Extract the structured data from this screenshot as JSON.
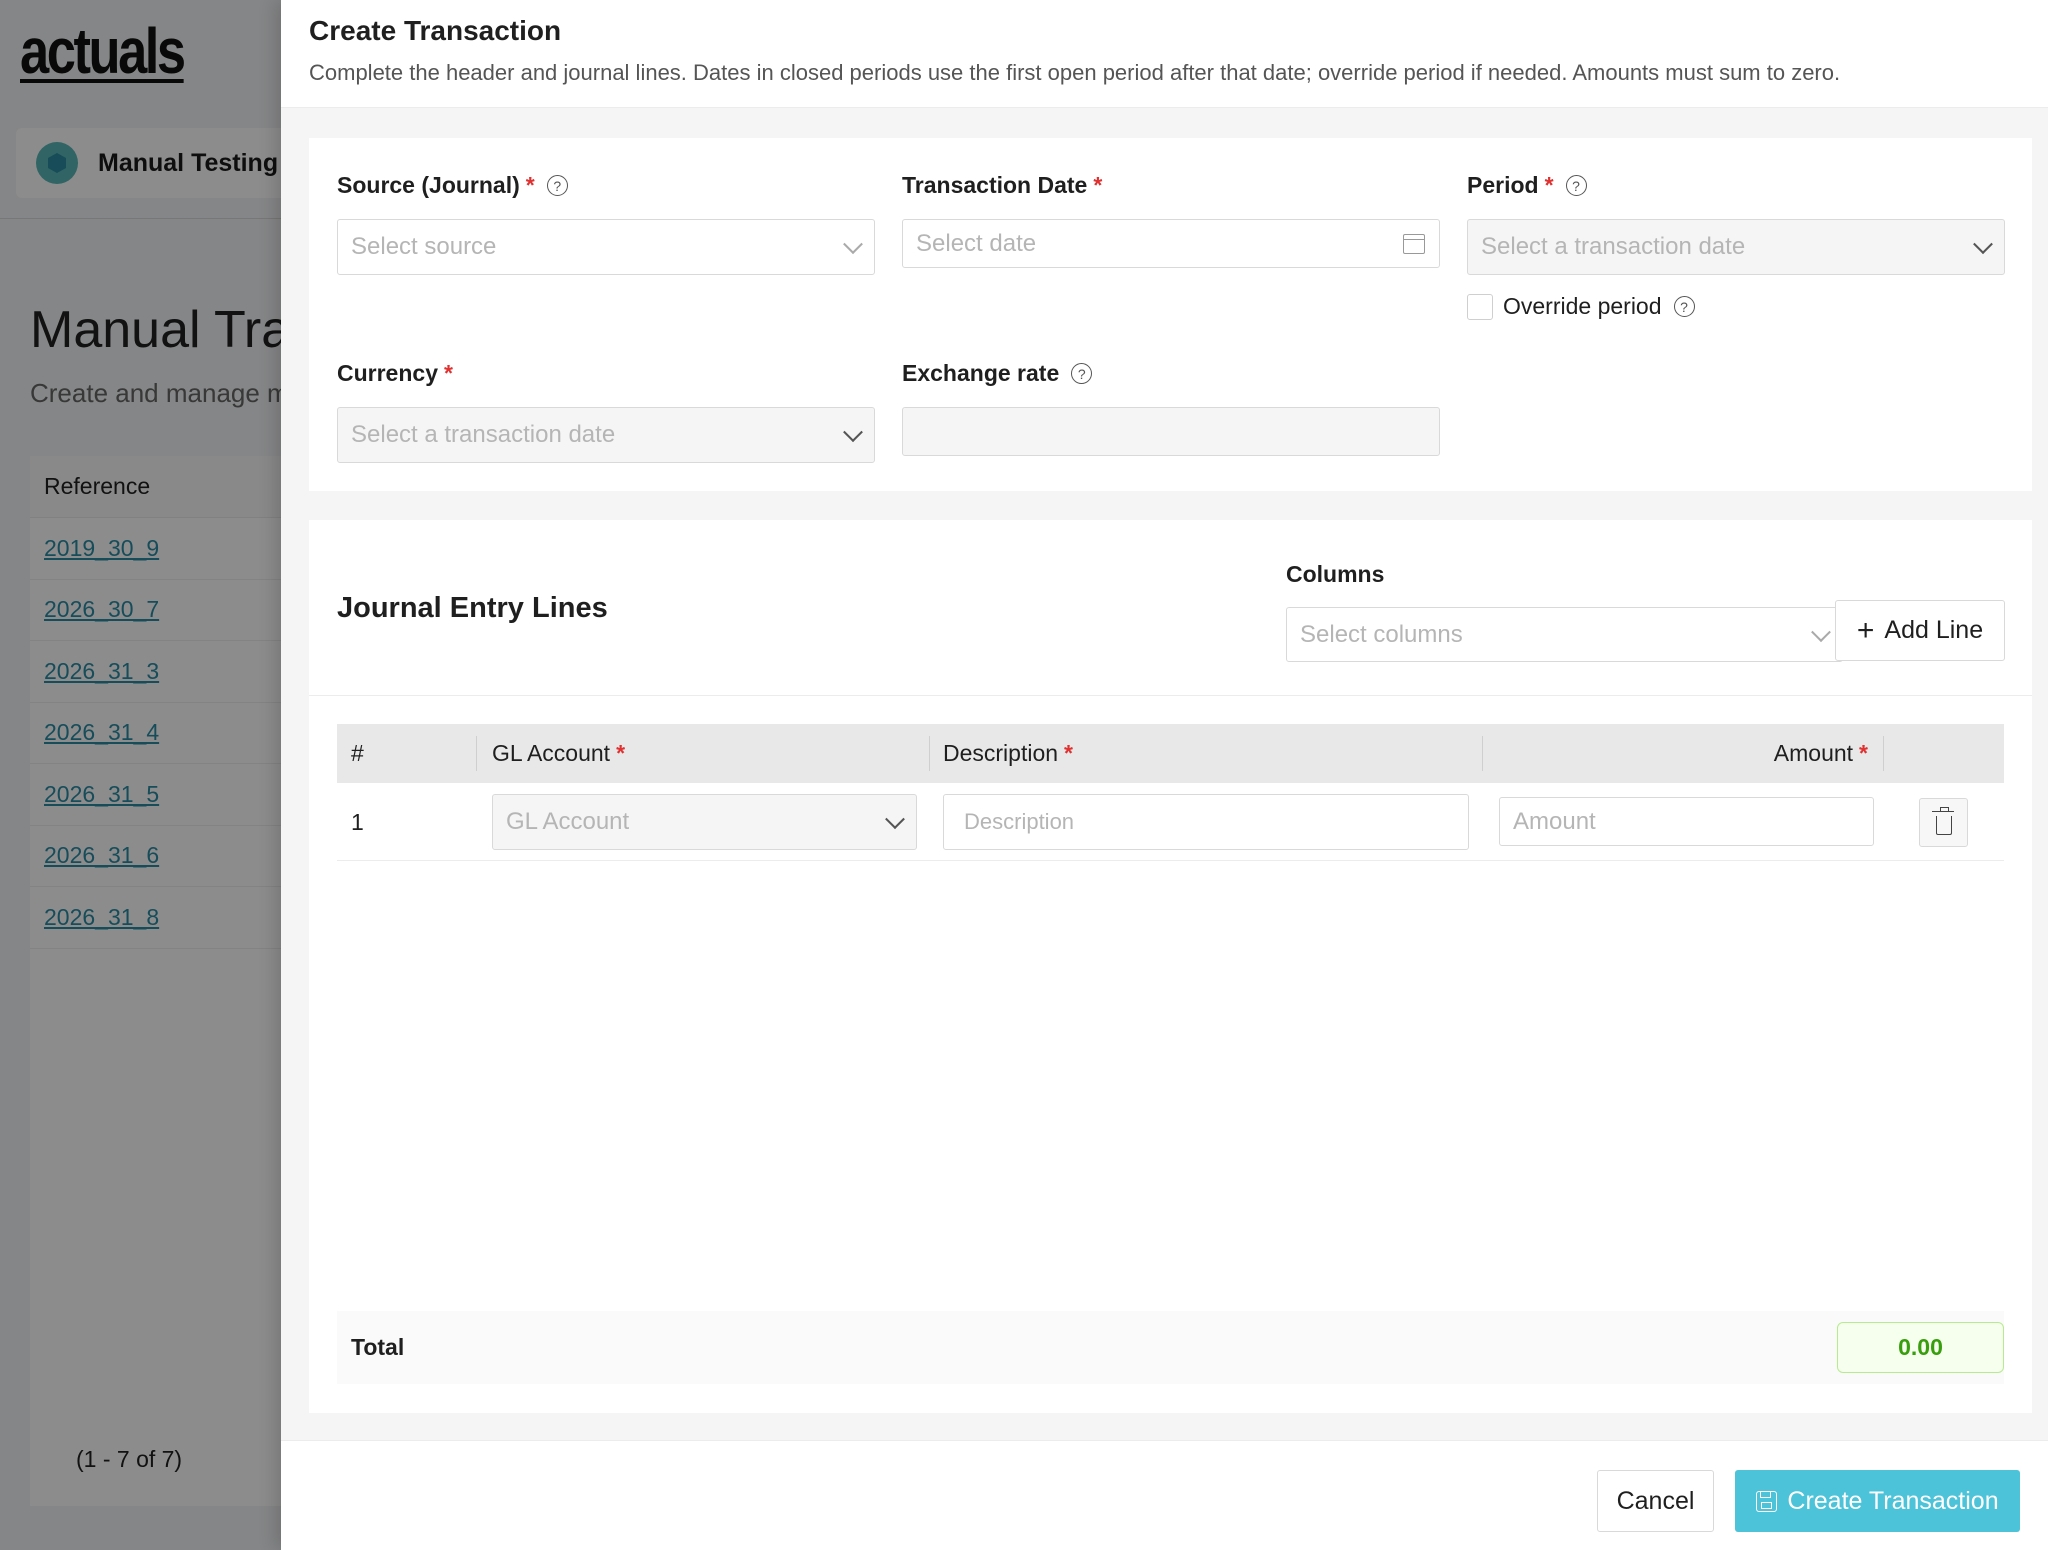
{
  "background": {
    "logo": "actuals",
    "workspace": "Manual Testing",
    "page_title": "Manual Trar",
    "page_subtitle": "Create and manage m",
    "table_header": "Reference",
    "references": [
      "2019_30_9",
      "2026_30_7",
      "2026_31_3",
      "2026_31_4",
      "2026_31_5",
      "2026_31_6",
      "2026_31_8"
    ],
    "pagination": "(1 - 7 of 7)"
  },
  "drawer": {
    "title": "Create Transaction",
    "description": "Complete the header and journal lines. Dates in closed periods use the first open period after that date; override period if needed. Amounts must sum to zero."
  },
  "header_form": {
    "source": {
      "label": "Source (Journal)",
      "placeholder": "Select source"
    },
    "transaction_date": {
      "label": "Transaction Date",
      "placeholder": "Select date"
    },
    "period": {
      "label": "Period",
      "placeholder": "Select a transaction date"
    },
    "override_period": {
      "label": "Override period",
      "checked": false
    },
    "currency": {
      "label": "Currency",
      "placeholder": "Select a transaction date"
    },
    "exchange_rate": {
      "label": "Exchange rate",
      "value": ""
    }
  },
  "journal_lines": {
    "title": "Journal Entry Lines",
    "columns_label": "Columns",
    "columns_placeholder": "Select columns",
    "add_line_label": "Add Line",
    "table_headers": {
      "num": "#",
      "gl_account": "GL Account",
      "description": "Description",
      "amount": "Amount"
    },
    "rows": [
      {
        "num": "1",
        "gl_account_placeholder": "GL Account",
        "description_placeholder": "Description",
        "amount_placeholder": "Amount"
      }
    ],
    "total_label": "Total",
    "total_value": "0.00"
  },
  "footer": {
    "cancel_label": "Cancel",
    "create_label": "Create Transaction"
  },
  "colors": {
    "primary": "#4cc3d9",
    "required": "#e03131",
    "total_text": "#389e0d",
    "link": "#2a8ca4"
  }
}
